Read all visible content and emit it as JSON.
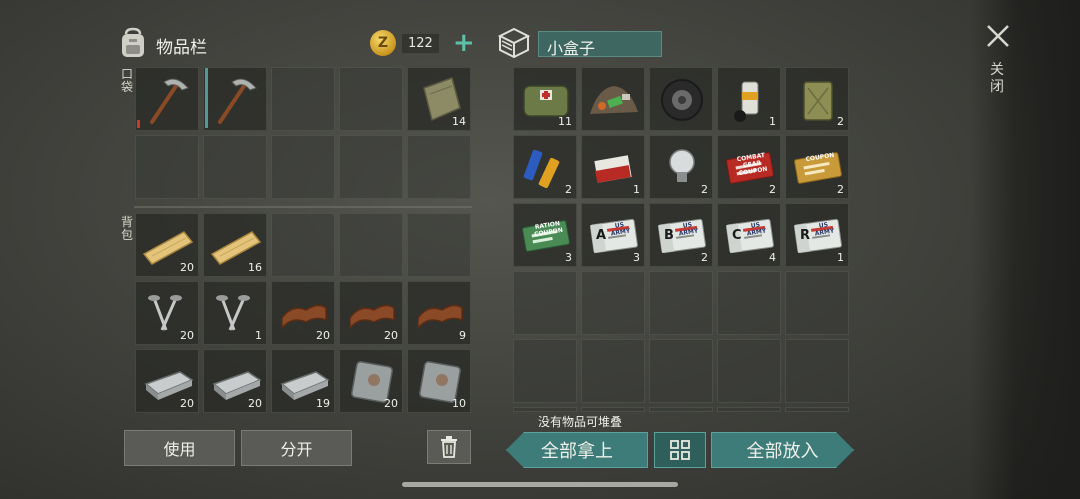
{
  "inventory": {
    "title": "物品栏",
    "coins": "122",
    "coin_symbol": "Z",
    "pocket_label": "口袋",
    "backpack_label": "背包",
    "pocket_slots": [
      {
        "item": "pickaxe-icon",
        "count": ""
      },
      {
        "item": "pickaxe-icon",
        "count": ""
      },
      {
        "item": "",
        "count": ""
      },
      {
        "item": "",
        "count": ""
      },
      {
        "item": "cloth-icon",
        "count": "14"
      },
      {
        "item": "",
        "count": ""
      },
      {
        "item": "",
        "count": ""
      },
      {
        "item": "",
        "count": ""
      },
      {
        "item": "",
        "count": ""
      },
      {
        "item": "",
        "count": ""
      }
    ],
    "backpack_slots": [
      {
        "item": "plank-icon",
        "count": "20"
      },
      {
        "item": "plank-icon",
        "count": "16"
      },
      {
        "item": "",
        "count": ""
      },
      {
        "item": "",
        "count": ""
      },
      {
        "item": "",
        "count": ""
      },
      {
        "item": "nails-icon",
        "count": "20"
      },
      {
        "item": "nails-icon",
        "count": "1"
      },
      {
        "item": "leather-icon",
        "count": "20"
      },
      {
        "item": "leather-icon",
        "count": "20"
      },
      {
        "item": "leather-icon",
        "count": "9"
      },
      {
        "item": "iron-bar-icon",
        "count": "20"
      },
      {
        "item": "iron-bar-icon",
        "count": "20"
      },
      {
        "item": "iron-bar-icon",
        "count": "19"
      },
      {
        "item": "metal-plate-icon",
        "count": "20"
      },
      {
        "item": "metal-plate-icon",
        "count": "10"
      }
    ],
    "use_label": "使用",
    "split_label": "分开"
  },
  "box": {
    "title": "小盒子",
    "slots": [
      {
        "item": "medkit-bag-icon",
        "count": "11"
      },
      {
        "item": "scrap-pile-icon",
        "count": ""
      },
      {
        "item": "tire-icon",
        "count": ""
      },
      {
        "item": "spray-can-icon",
        "count": "1"
      },
      {
        "item": "jerrycan-icon",
        "count": "2"
      },
      {
        "item": "batteries-icon",
        "count": "2"
      },
      {
        "item": "cigarettes-icon",
        "count": "1"
      },
      {
        "item": "lightbulb-icon",
        "count": "2"
      },
      {
        "item": "combat-coupon-icon",
        "count": "2",
        "text": "COMBAT GEAR COUPON"
      },
      {
        "item": "coupon-gold-icon",
        "count": "2",
        "text": "COUPON"
      },
      {
        "item": "ration-coupon-icon",
        "count": "3",
        "text": "RATION COUPON"
      },
      {
        "item": "army-card-a-icon",
        "count": "3",
        "text": "US ARMY",
        "letter": "A"
      },
      {
        "item": "army-card-b-icon",
        "count": "2",
        "text": "US ARMY",
        "letter": "B"
      },
      {
        "item": "army-card-c-icon",
        "count": "4",
        "text": "US ARMY",
        "letter": "C"
      },
      {
        "item": "army-card-r-icon",
        "count": "1",
        "text": "US ARMY",
        "letter": "R"
      }
    ],
    "hint": "没有物品可堆叠",
    "take_all_label": "全部拿上",
    "put_all_label": "全部放入"
  },
  "close_label": "关闭",
  "colors": {
    "teal": "#3d7c78",
    "teal_light": "#5aa29c",
    "coin": "#e0b23a",
    "plus": "#5fc0a8"
  }
}
